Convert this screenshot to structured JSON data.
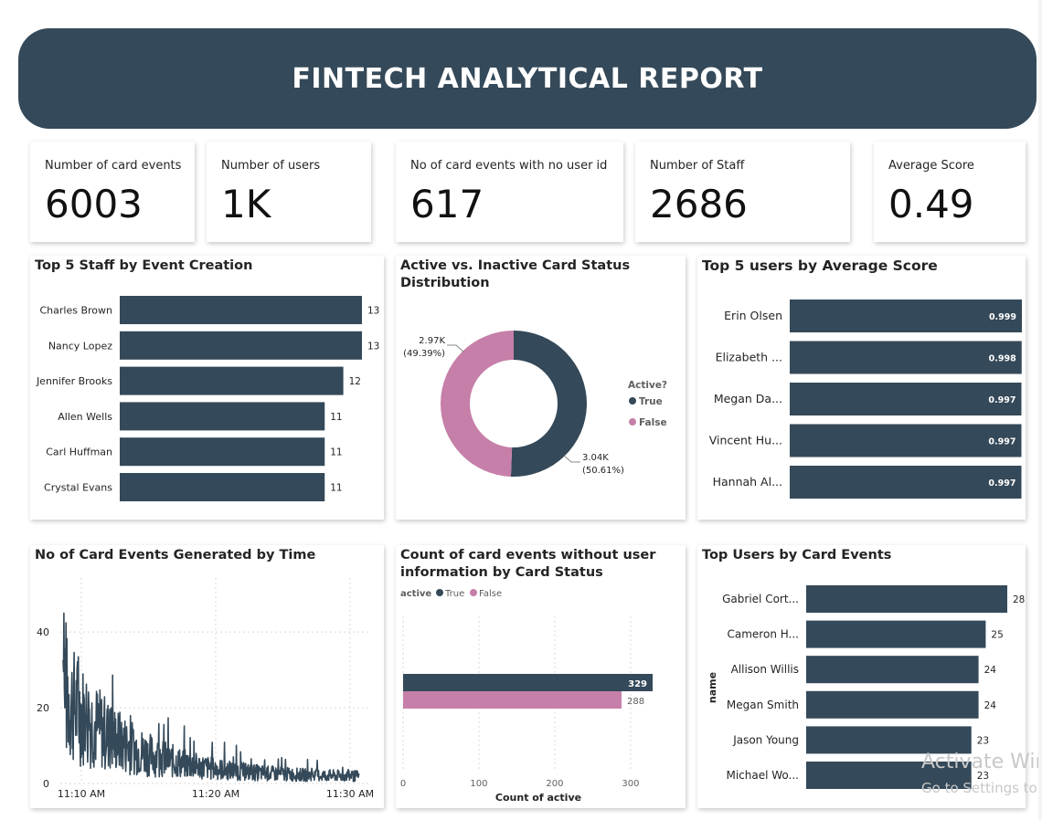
{
  "header": {
    "title": "FINTECH ANALYTICAL REPORT"
  },
  "kpis": [
    {
      "label": "Number of card events",
      "value": "6003"
    },
    {
      "label": "Number of users",
      "value": "1K"
    },
    {
      "label": "No of card events with no user id",
      "value": "617"
    },
    {
      "label": "Number of Staff",
      "value": "2686"
    },
    {
      "label": "Average Score",
      "value": "0.49"
    }
  ],
  "colors": {
    "navy": "#344959",
    "pink": "#c67fa8",
    "header": "#344959"
  },
  "chart_data": [
    {
      "id": "top_staff",
      "type": "bar",
      "orientation": "horizontal",
      "title": "Top 5 Staff by Event Creation",
      "categories": [
        "Charles Brown",
        "Nancy Lopez",
        "Jennifer Brooks",
        "Allen Wells",
        "Carl Huffman",
        "Crystal Evans"
      ],
      "values": [
        13,
        13,
        12,
        11,
        11,
        11
      ],
      "labels": [
        "13",
        "13",
        "12",
        "11",
        "11",
        "11"
      ],
      "xlim": [
        0,
        13
      ]
    },
    {
      "id": "active_status",
      "type": "pie",
      "donut": true,
      "title": "Active vs. Inactive Card Status Distribution",
      "legend_title": "Active?",
      "legend_position": "right",
      "slices": [
        {
          "name": "True",
          "value": 3038,
          "label": "3.04K",
          "pct": "(50.61%)"
        },
        {
          "name": "False",
          "value": 2965,
          "label": "2.97K",
          "pct": "(49.39%)"
        }
      ]
    },
    {
      "id": "top_users_score",
      "type": "bar",
      "orientation": "horizontal",
      "title": "Top 5 users by Average Score",
      "categories": [
        "Erin Olsen",
        "Elizabeth ...",
        "Megan Da...",
        "Vincent Hu...",
        "Hannah Al..."
      ],
      "values": [
        0.999,
        0.998,
        0.997,
        0.997,
        0.997
      ],
      "labels": [
        "0.999",
        "0.998",
        "0.997",
        "0.997",
        "0.997"
      ],
      "xlim": [
        0,
        0.999
      ]
    },
    {
      "id": "events_by_time",
      "type": "line",
      "title": "No of Card Events Generated by Time",
      "x_ticks": [
        "11:10 AM",
        "11:20 AM",
        "11:30 AM"
      ],
      "y_ticks": [
        "0",
        "20",
        "40"
      ],
      "ylim": [
        0,
        48
      ],
      "grid": true,
      "seed": 7,
      "n_points": 700
    },
    {
      "id": "no_user_by_status",
      "type": "bar",
      "orientation": "horizontal",
      "title": "Count of card events without user information by Card Status",
      "legend_title": "active",
      "legend_position": "top-left",
      "series": [
        {
          "name": "True",
          "value": 329,
          "label": "329"
        },
        {
          "name": "False",
          "value": 288,
          "label": "288"
        }
      ],
      "x_ticks": [
        "0",
        "100",
        "200",
        "300"
      ],
      "xlim": [
        0,
        329
      ],
      "xlabel": "Count of active"
    },
    {
      "id": "top_users_events",
      "type": "bar",
      "orientation": "horizontal",
      "title": "Top Users by Card Events",
      "ylabel": "name",
      "categories": [
        "Gabriel Cort...",
        "Cameron H...",
        "Allison Willis",
        "Megan Smith",
        "Jason Young",
        "Michael Wo..."
      ],
      "values": [
        28,
        25,
        24,
        24,
        23,
        23
      ],
      "labels": [
        "28",
        "25",
        "24",
        "24",
        "23",
        "23"
      ],
      "xlim": [
        0,
        28
      ]
    }
  ],
  "watermark": {
    "line1": "Activate Wir",
    "line2": "Go to Settings to"
  }
}
